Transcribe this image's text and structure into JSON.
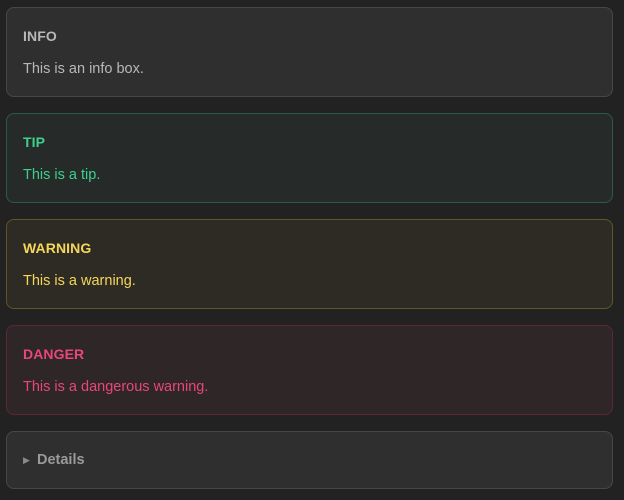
{
  "callouts": {
    "info": {
      "title": "INFO",
      "text": "This is an info box."
    },
    "tip": {
      "title": "TIP",
      "text": "This is a tip."
    },
    "warning": {
      "title": "WARNING",
      "text": "This is a warning."
    },
    "danger": {
      "title": "DANGER",
      "text": "This is a dangerous warning."
    }
  },
  "details": {
    "marker_icon": "triangle-right-icon",
    "summary": "Details"
  },
  "colors": {
    "background": "#222222",
    "info": "#b8b8b8",
    "tip": "#3ecf8e",
    "warning": "#f5d65a",
    "danger": "#e8467c"
  }
}
